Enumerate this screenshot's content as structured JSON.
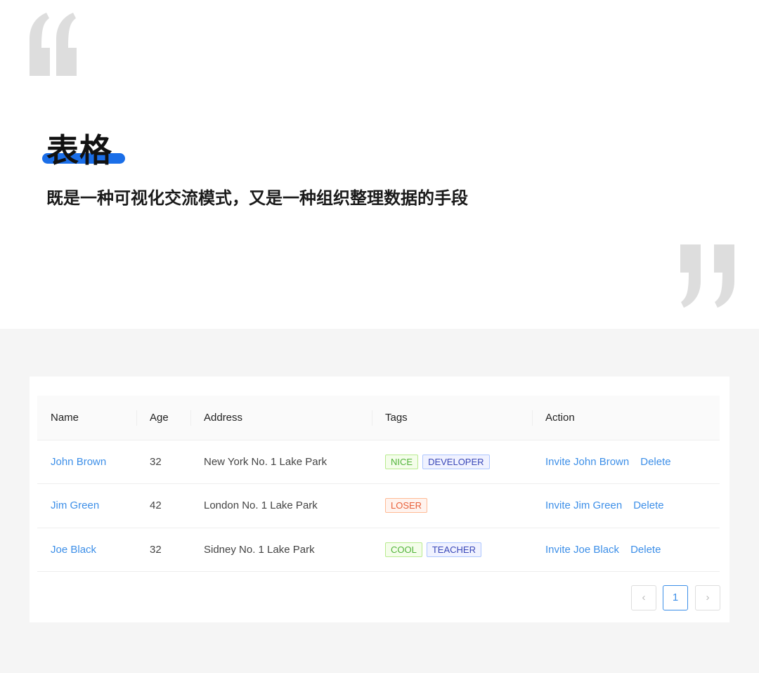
{
  "header": {
    "title": "表格",
    "subtitle": "既是一种可视化交流模式，又是一种组织整理数据的手段"
  },
  "colors": {
    "accent": "#1a6ee8",
    "link": "#3d8fe8",
    "quote": "#dddddd"
  },
  "table": {
    "columns": [
      "Name",
      "Age",
      "Address",
      "Tags",
      "Action"
    ],
    "rows": [
      {
        "name": "John Brown",
        "age": "32",
        "address": "New York No. 1 Lake Park",
        "tags": [
          "NICE",
          "DEVELOPER"
        ],
        "invite": "Invite John Brown",
        "delete": "Delete"
      },
      {
        "name": "Jim Green",
        "age": "42",
        "address": "London No. 1 Lake Park",
        "tags": [
          "LOSER"
        ],
        "invite": "Invite Jim Green",
        "delete": "Delete"
      },
      {
        "name": "Joe Black",
        "age": "32",
        "address": "Sidney No. 1 Lake Park",
        "tags": [
          "COOL",
          "TEACHER"
        ],
        "invite": "Invite Joe Black",
        "delete": "Delete"
      }
    ]
  },
  "pagination": {
    "prev": "‹",
    "current": "1",
    "next": "›"
  }
}
